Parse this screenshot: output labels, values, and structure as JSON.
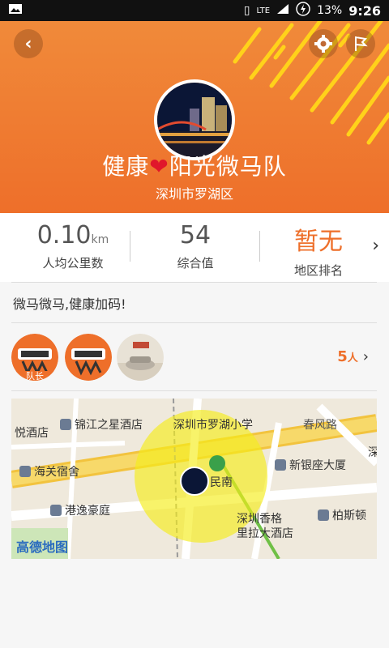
{
  "status": {
    "battery": "13%",
    "time": "9:26",
    "network": "LTE"
  },
  "header": {
    "team_name_part1": "健康",
    "team_name_part2": "阳光微马队",
    "city": "深圳市罗湖区"
  },
  "stats": [
    {
      "value": "0.10",
      "unit": "km",
      "label": "人均公里数"
    },
    {
      "value": "54",
      "label": "综合值"
    },
    {
      "value": "暂无",
      "label": "地区排名"
    }
  ],
  "slogan": "微马微马,健康加码!",
  "members": {
    "captain_label": "队长",
    "count": "5",
    "count_unit": "人"
  },
  "map": {
    "labels": [
      "锦江之星酒店",
      "深圳市罗湖小学",
      "春风路",
      "海关宿舍",
      "新银座大厦",
      "民南",
      "港逸豪庭",
      "深圳香格",
      "里拉大酒店",
      "柏斯顿",
      "悦酒店",
      "深"
    ],
    "logo": "高德地图"
  },
  "colors": {
    "accent": "#ee6f2a",
    "header": "#f08a3a"
  }
}
